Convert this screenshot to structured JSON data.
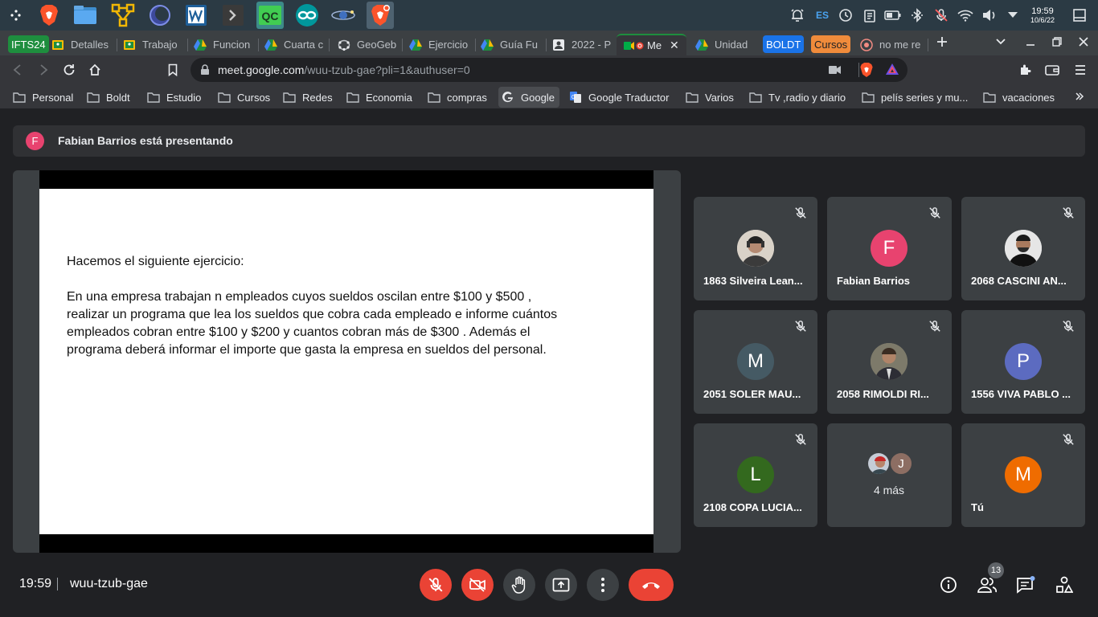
{
  "taskbar": {
    "apps": [
      {
        "icon": "app-menu-icon"
      },
      {
        "icon": "brave-icon"
      },
      {
        "icon": "file-manager-icon"
      },
      {
        "icon": "yed-icon"
      },
      {
        "icon": "eclipse-icon"
      },
      {
        "icon": "wireshark-icon"
      },
      {
        "icon": "terminal-icon"
      },
      {
        "icon": "qtcreator-icon",
        "label": "QC"
      },
      {
        "icon": "arduino-icon"
      },
      {
        "icon": "kstars-icon"
      },
      {
        "icon": "brave-active-icon"
      }
    ],
    "language": "ES",
    "clock": {
      "time": "19:59",
      "date": "10/6/22"
    }
  },
  "tabs": {
    "group_label": "IFTS24",
    "items": [
      {
        "label": "Detalles",
        "icon": "classroom-icon"
      },
      {
        "label": "Trabajo",
        "icon": "classroom-icon"
      },
      {
        "label": "Funcion",
        "icon": "drive-icon"
      },
      {
        "label": "Cuarta c",
        "icon": "drive-icon"
      },
      {
        "label": "GeoGeb",
        "icon": "geogebra-icon"
      },
      {
        "label": "Ejercicio",
        "icon": "drive-icon"
      },
      {
        "label": "Guía Fu",
        "icon": "drive-icon"
      },
      {
        "label": "2022 - P",
        "icon": "contact-icon"
      },
      {
        "label": "Me",
        "icon": "meet-icon",
        "active": true
      },
      {
        "label": "Unidad",
        "icon": "drive-icon"
      }
    ],
    "group2_label": "BOLDT",
    "group3_label": "Cursos",
    "last_tab": {
      "label": "no me re",
      "icon": "brave-tab-icon"
    }
  },
  "address_bar": {
    "url_host": "meet.google.com",
    "url_rest": "/wuu-tzub-gae?pli=1&authuser=0"
  },
  "bookmarks": [
    {
      "label": "Personal",
      "icon": "folder-icon"
    },
    {
      "label": "Boldt",
      "icon": "folder-icon"
    },
    {
      "label": "Estudio",
      "icon": "folder-icon"
    },
    {
      "label": "Cursos",
      "icon": "folder-icon"
    },
    {
      "label": "Redes",
      "icon": "folder-icon"
    },
    {
      "label": "Economia",
      "icon": "folder-icon"
    },
    {
      "label": "compras",
      "icon": "folder-icon"
    },
    {
      "label": "Google",
      "icon": "google-icon"
    },
    {
      "label": "Google Traductor",
      "icon": "translate-icon"
    },
    {
      "label": "Varios",
      "icon": "folder-icon"
    },
    {
      "label": "Tv ,radio y diario",
      "icon": "folder-icon"
    },
    {
      "label": "pelís series y mu...",
      "icon": "folder-icon"
    },
    {
      "label": "vacaciones",
      "icon": "folder-icon"
    }
  ],
  "meet": {
    "presenter_initial": "F",
    "presenting_text": "Fabian Barrios está presentando",
    "slide": {
      "heading": "Hacemos el siguiente ejercicio:",
      "line1": "En una empresa trabajan n empleados cuyos sueldos oscilan entre $100 y $500 ,",
      "line2": "realizar un programa que lea los sueldos que cobra cada empleado e informe cuántos",
      "line3": "empleados cobran entre $100 y $200 y cuantos cobran más de $300 . Además el",
      "line4": "programa deberá informar el importe que gasta la empresa en sueldos del personal."
    },
    "participants": [
      {
        "name": "1863 Silveira Lean...",
        "initial": "",
        "color": "#8d7a6a",
        "photo": true
      },
      {
        "name": "Fabian Barrios",
        "initial": "F",
        "color": "#e8436f"
      },
      {
        "name": "2068 CASCINI AN...",
        "initial": "",
        "color": "#444",
        "photo": true
      },
      {
        "name": "2051 SOLER MAU...",
        "initial": "M",
        "color": "#455a64"
      },
      {
        "name": "2058 RIMOLDI RI...",
        "initial": "",
        "color": "#6d6a5c",
        "photo": true
      },
      {
        "name": "1556 VIVA PABLO ...",
        "initial": "P",
        "color": "#5c6bc0"
      },
      {
        "name": "2108 COPA LUCIA...",
        "initial": "L",
        "color": "#33691e"
      },
      {
        "name": "Tú",
        "initial": "M",
        "color": "#ef6c00"
      }
    ],
    "more": {
      "label": "4 más",
      "initial": "J"
    },
    "bottom": {
      "time": "19:59",
      "code": "wuu-tzub-gae",
      "participant_count": "13"
    }
  }
}
